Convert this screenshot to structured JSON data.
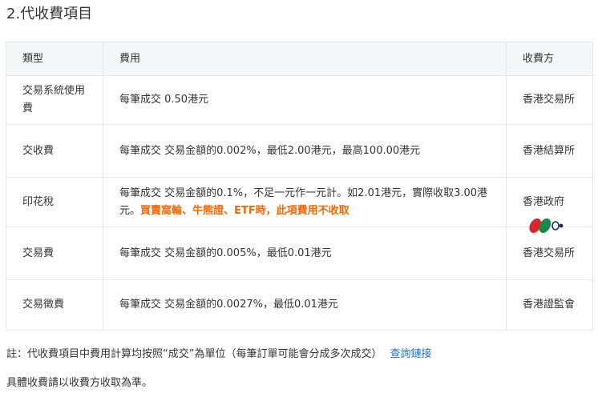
{
  "title": "2.代收費項目",
  "table": {
    "headers": [
      "類型",
      "費用",
      "收費方"
    ],
    "rows": [
      {
        "type": "交易系統使用費",
        "fee": "每筆成交 0.50港元",
        "party": "香港交易所"
      },
      {
        "type": "交收費",
        "fee": "每筆成交 交易金額的0.002%，最低2.00港元，最高100.00港元",
        "party": "香港結算所"
      },
      {
        "type": "印花稅",
        "fee": "每筆成交 交易金額的0.1%，不足一元作一元計。如2.01港元，實際收取3.00港元。",
        "fee_highlight": "買賣窩輪、牛熊證、ETF時，此項費用不收取",
        "party": "香港政府"
      },
      {
        "type": "交易費",
        "fee": "每筆成交 交易金額的0.005%，最低0.01港元",
        "party": "香港交易所"
      },
      {
        "type": "交易徵費",
        "fee": "每筆成交 交易金額的0.0027%，最低0.01港元",
        "party": "香港證監會"
      }
    ]
  },
  "note": {
    "text": "註：代收費項目中費用計算均按照“成交”為單位（每筆訂單可能會分成多次成交）",
    "link": "查詢鏈接"
  },
  "footer": "具體收費請以收費方收取為準。",
  "colors": {
    "highlight": "#ff6600",
    "link": "#1e6fd9",
    "logo_red": "#d7262c",
    "logo_green": "#1a8a4a"
  },
  "icons": {
    "watermark": "stock-logo-icon"
  }
}
